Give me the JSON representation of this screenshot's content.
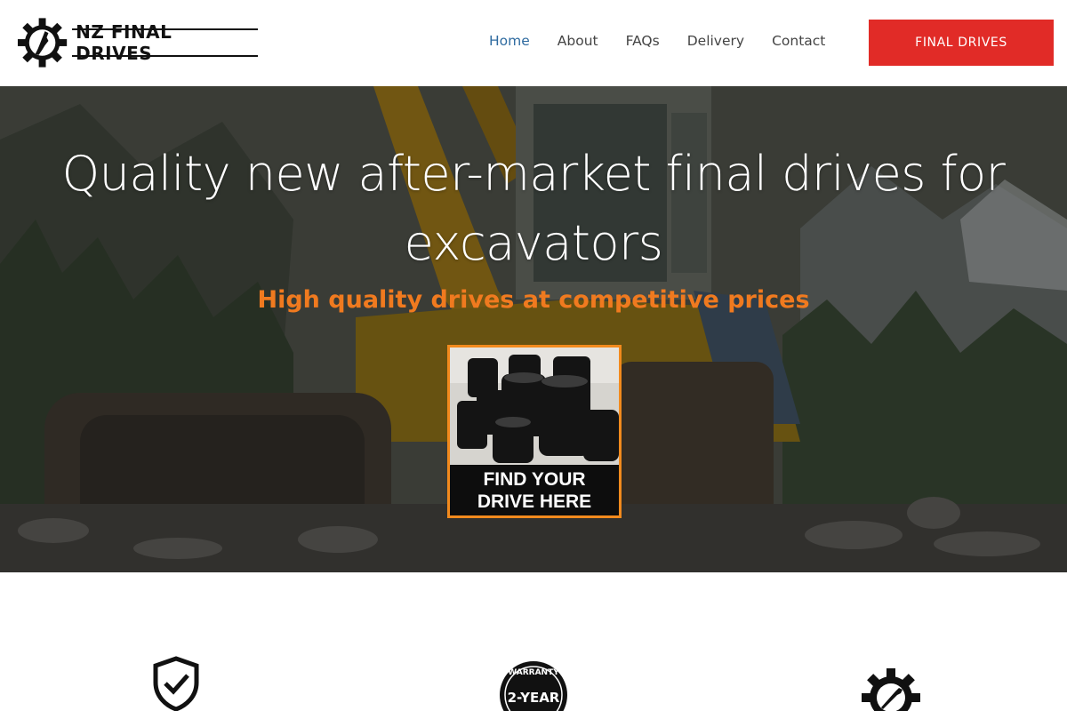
{
  "header": {
    "logo_text": "NZ FINAL DRIVES",
    "nav": [
      {
        "label": "Home",
        "active": true
      },
      {
        "label": "About",
        "active": false
      },
      {
        "label": "FAQs",
        "active": false
      },
      {
        "label": "Delivery",
        "active": false
      },
      {
        "label": "Contact",
        "active": false
      }
    ],
    "cta_label": "FINAL DRIVES"
  },
  "hero": {
    "title": "Quality new after-market final drives for excavators",
    "subtitle": "High quality drives at competitive prices",
    "card_caption_line1": "FIND YOUR",
    "card_caption_line2": "DRIVE HERE"
  },
  "features": {
    "icons": [
      "shield-check-icon",
      "warranty-badge-icon",
      "gear-wrench-icon"
    ],
    "badge_top": "WARRANTY",
    "badge_main": "2-YEAR"
  },
  "colors": {
    "accent_red": "#e12b27",
    "accent_orange": "#f07a1f",
    "nav_active": "#2f6ba0"
  }
}
